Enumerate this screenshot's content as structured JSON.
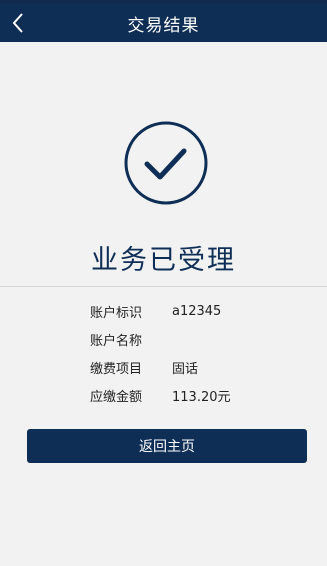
{
  "header": {
    "back_icon": "chevron-left-icon",
    "title": "交易结果"
  },
  "result": {
    "icon": "check-circle-icon",
    "title": "业务已受理"
  },
  "details": [
    {
      "label": "账户标识",
      "value": "a12345"
    },
    {
      "label": "账户名称",
      "value": ""
    },
    {
      "label": "缴费项目",
      "value": "固话"
    },
    {
      "label": "应缴金额",
      "value": "113.20元"
    }
  ],
  "actions": {
    "home_label": "返回主页"
  },
  "colors": {
    "primary": "#0f2e56",
    "background": "#f2f2f2"
  }
}
